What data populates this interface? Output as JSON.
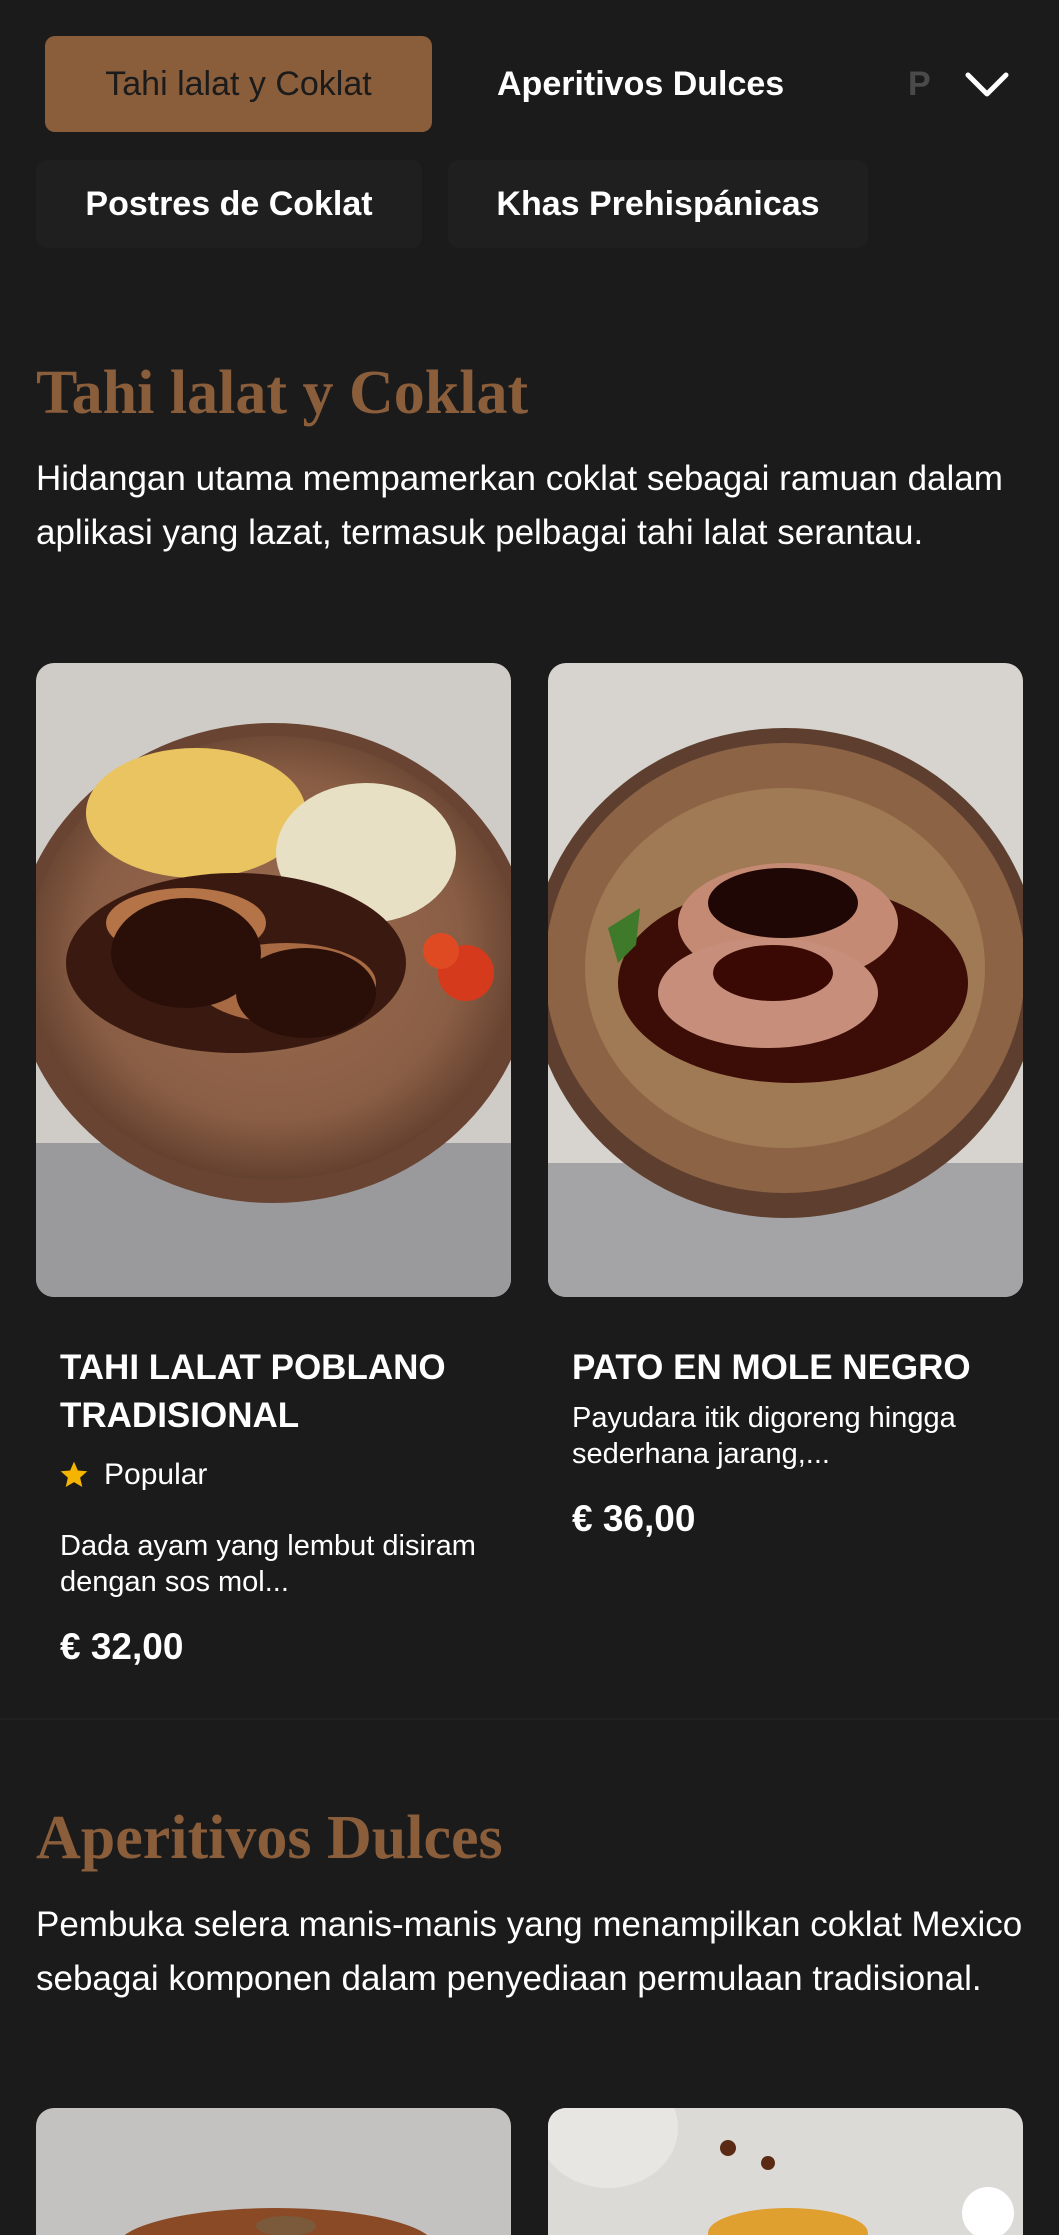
{
  "nav": {
    "tabs": [
      {
        "label": "Tahi lalat y Coklat",
        "active": true
      },
      {
        "label": "Aperitivos Dulces",
        "active": false
      },
      {
        "label": "P",
        "active": false
      }
    ],
    "chips": [
      {
        "label": "Postres de Coklat"
      },
      {
        "label": "Khas Prehispánicas"
      }
    ]
  },
  "sections": [
    {
      "title": "Tahi lalat y Coklat",
      "description": "Hidangan utama mempamerkan coklat sebagai ramuan dalam aplikasi yang lazat, termasuk pelbagai tahi lalat serantau.",
      "items": [
        {
          "name": "TAHI LALAT POBLANO TRADISIONAL",
          "badge": "Popular",
          "description": "Dada ayam yang lembut disiram dengan sos mol...",
          "price": "€ 32,00"
        },
        {
          "name": "PATO EN MOLE NEGRO",
          "description": "Payudara itik digoreng hingga sederhana jarang,...",
          "price": "€ 36,00"
        }
      ]
    },
    {
      "title": "Aperitivos Dulces",
      "description": "Pembuka selera manis-manis yang menampilkan coklat Mexico sebagai komponen dalam penyediaan permulaan tradisional."
    }
  ],
  "colors": {
    "background": "#1b1b1b",
    "accent": "#8a5d3b",
    "star": "#f4b400"
  },
  "icons": {
    "dropdown": "chevron-down-icon",
    "badge": "star-icon"
  }
}
